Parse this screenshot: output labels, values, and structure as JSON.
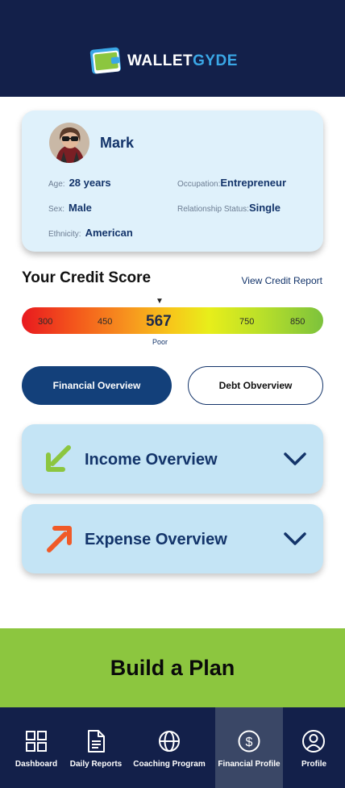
{
  "header": {
    "logo_word_1": "WALLET",
    "logo_word_2": "GYDE"
  },
  "profile": {
    "name": "Mark",
    "age_label": "Age:",
    "age_value": "28 years",
    "occupation_label": "Occupation:",
    "occupation_value": "Entrepreneur",
    "sex_label": "Sex:",
    "sex_value": "Male",
    "relationship_label": "Relationship Status:",
    "relationship_value": "Single",
    "ethnicity_label": "Ethnicity:",
    "ethnicity_value": "American"
  },
  "credit": {
    "title": "Your Credit Score",
    "link": "View Credit Report",
    "score": "567",
    "rating": "Poor",
    "ticks": [
      "300",
      "450",
      "750",
      "850"
    ],
    "score_fraction": 0.45
  },
  "tabs": {
    "financial": "Financial Overview",
    "debt": "Debt Obverview"
  },
  "sections": {
    "income": {
      "title": "Income Overview",
      "arrow_color": "#8cc63f"
    },
    "expense": {
      "title": "Expense Overview",
      "arrow_color": "#f05a28"
    }
  },
  "cta": {
    "label": "Build a Plan"
  },
  "nav": {
    "dashboard": "Dashboard",
    "daily_reports": "Daily Reports",
    "coaching": "Coaching Program",
    "financial_profile": "Financial Profile",
    "profile": "Profile",
    "active": "financial_profile"
  },
  "colors": {
    "header": "#13204a",
    "accent_green": "#8cc63f",
    "primary_blue": "#13407a",
    "card_bg": "#dff1fb"
  }
}
